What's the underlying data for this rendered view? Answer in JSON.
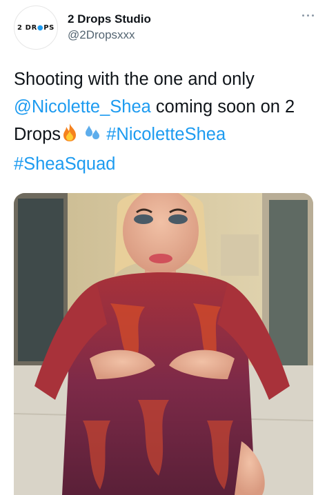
{
  "author": {
    "avatar_logo_text": "2 DR PS",
    "display_name": "2 Drops Studio",
    "handle": "@2Dropsxxx"
  },
  "tweet": {
    "text_part1": "Shooting with the one and only ",
    "mention": "@Nicolette_Shea",
    "text_part2": " coming soon on 2 Drops",
    "emoji_1": "fire-emoji",
    "emoji_2": "sweat-droplets-emoji",
    "hashtag_1": "#NicoletteShea",
    "hashtag_2": "#SheaSquad"
  },
  "colors": {
    "link": "#1d9bf0",
    "text": "#0f1419",
    "secondary": "#536471"
  },
  "icons": {
    "more": "more-horizontal-icon"
  }
}
